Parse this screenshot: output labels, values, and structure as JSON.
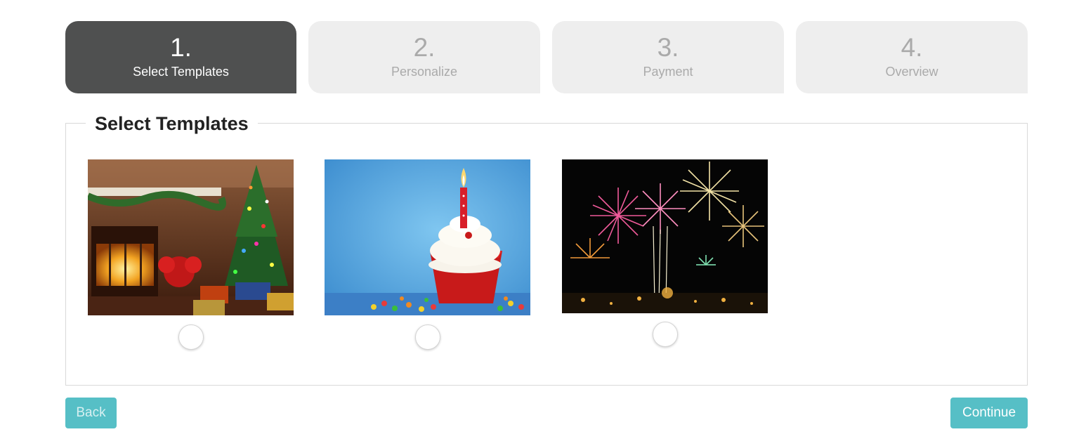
{
  "steps": [
    {
      "number": "1.",
      "label": "Select Templates",
      "active": true
    },
    {
      "number": "2.",
      "label": "Personalize",
      "active": false
    },
    {
      "number": "3.",
      "label": "Payment",
      "active": false
    },
    {
      "number": "4.",
      "label": "Overview",
      "active": false
    }
  ],
  "section": {
    "title": "Select Templates"
  },
  "templates": [
    {
      "name": "christmas",
      "selected": false
    },
    {
      "name": "birthday",
      "selected": false
    },
    {
      "name": "fireworks",
      "selected": false
    }
  ],
  "buttons": {
    "back_label": "Back",
    "continue_label": "Continue"
  },
  "colors": {
    "active_step": "#4f5050",
    "inactive_step": "#eeeeee",
    "button": "#56bfc6"
  }
}
